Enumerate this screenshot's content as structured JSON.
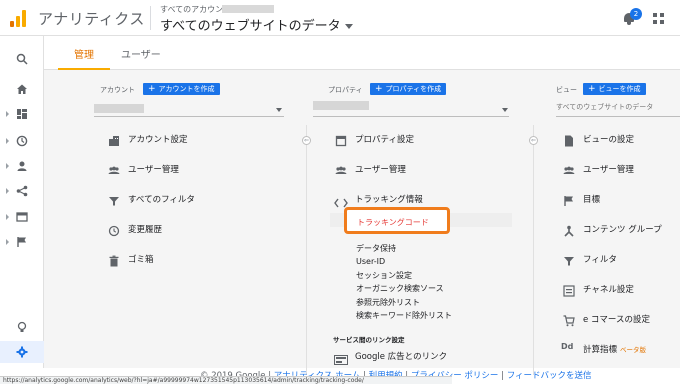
{
  "header": {
    "app_title": "アナリティクス",
    "account_label": "すべてのアカウント",
    "property_view": "すべてのウェブサイトのデータ",
    "notification_count": "2"
  },
  "tabs": {
    "admin": "管理",
    "user": "ユーザー"
  },
  "account_col": {
    "label": "アカウント",
    "create": "アカウントを作成",
    "items": [
      "アカウント設定",
      "ユーザー管理",
      "すべてのフィルタ",
      "変更履歴",
      "ゴミ箱"
    ]
  },
  "property_col": {
    "label": "プロパティ",
    "create": "プロパティを作成",
    "items": [
      "プロパティ設定",
      "ユーザー管理"
    ],
    "tracking": "トラッキング情報",
    "tracking_sub": [
      "トラッキングコード",
      "データ保持",
      "User-ID",
      "セッション設定",
      "オーガニック検索ソース",
      "参照元除外リスト",
      "検索キーワード除外リスト"
    ],
    "link_section": "サービス間のリンク設定",
    "link_item": "Google 広告とのリンク"
  },
  "view_col": {
    "label": "ビュー",
    "create": "ビューを作成",
    "view_name": "すべてのウェブサイトのデータ",
    "items": [
      "ビューの設定",
      "ユーザー管理",
      "目標",
      "コンテンツ グループ",
      "フィルタ",
      "チャネル設定",
      "e コマースの設定",
      "計算指標"
    ],
    "beta": "ベータ版"
  },
  "footer": {
    "copyright": "© 2019 Google",
    "link1": "アナリティクス ホーム",
    "link2": "利用規約",
    "link3": "プライバシー ポリシー",
    "link4": "フィードバックを送信",
    "sep": " | "
  },
  "statusbar": "https://analytics.google.com/analytics/web/?hl=ja#/a99999974w127351545p113035614/admin/tracking/tracking-code/",
  "colors": {
    "accent": "#e37400",
    "primary": "#1a73e8",
    "highlight": "#f07c1c"
  }
}
